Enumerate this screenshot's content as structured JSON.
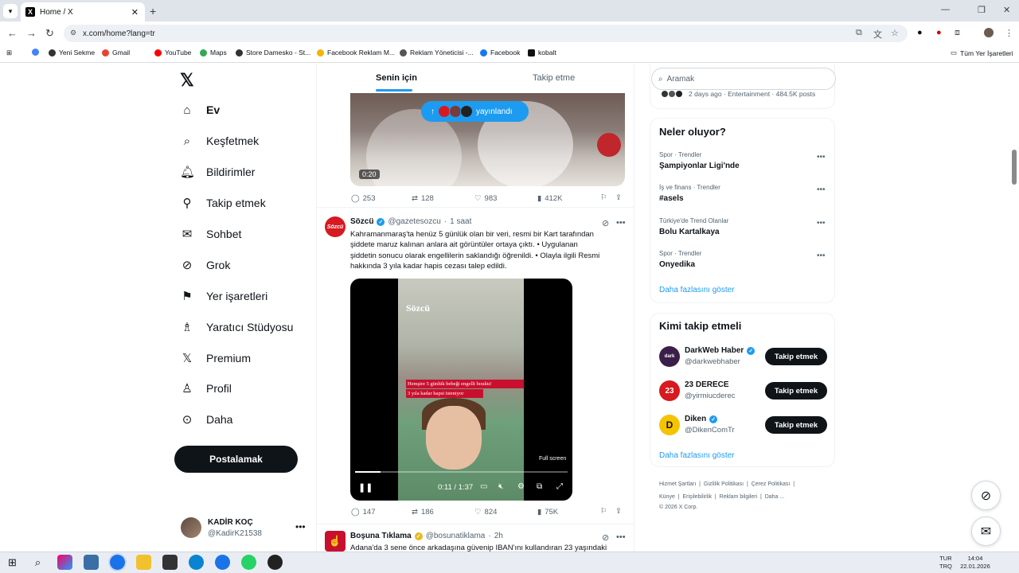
{
  "browser": {
    "tab_title": "Home / X",
    "url": "x.com/home?lang=tr",
    "bookmarks": [
      {
        "label": "Yeni Sekme",
        "color": "#333"
      },
      {
        "label": "Gmail",
        "color": "#ea4335"
      },
      {
        "label": "YouTube",
        "color": "#ff0000"
      },
      {
        "label": "Maps",
        "color": "#34a853"
      },
      {
        "label": "Store Damesko - St...",
        "color": "#333"
      },
      {
        "label": "Facebook Reklam M...",
        "color": "#f4b400"
      },
      {
        "label": "Reklam Yöneticisi -...",
        "color": "#555"
      },
      {
        "label": "Facebook",
        "color": "#1877f2"
      },
      {
        "label": "kobalt",
        "color": "#111"
      }
    ],
    "all_bookmarks": "Tüm Yer İşaretleri"
  },
  "nav": {
    "items": [
      {
        "label": "Ev",
        "icon": "home-icon"
      },
      {
        "label": "Keşfetmek",
        "icon": "search-icon"
      },
      {
        "label": "Bildirimler",
        "icon": "bell-icon"
      },
      {
        "label": "Takip etmek",
        "icon": "person-add-icon"
      },
      {
        "label": "Sohbet",
        "icon": "mail-icon"
      },
      {
        "label": "Grok",
        "icon": "grok-icon"
      },
      {
        "label": "Yer işaretleri",
        "icon": "bookmark-icon"
      },
      {
        "label": "Yaratıcı Stüdyosu",
        "icon": "studio-icon"
      },
      {
        "label": "Premium",
        "icon": "x-icon"
      },
      {
        "label": "Profil",
        "icon": "person-icon"
      },
      {
        "label": "Daha",
        "icon": "more-icon"
      }
    ],
    "post_label": "Postalamak",
    "user": {
      "name": "KADİR KOÇ",
      "handle": "@KadirK21538"
    }
  },
  "feed": {
    "tabs": [
      "Senin için",
      "Takip etme"
    ],
    "new_posts_label": "yayınlandı",
    "video1_time": "0:20",
    "tweet1_stats": {
      "replies": "253",
      "reposts": "128",
      "likes": "983",
      "views": "412K"
    },
    "tweet2": {
      "name": "Sözcü",
      "handle": "@gazetesozcu",
      "time": "1 saat",
      "lines": [
        "Kahramanmaraş'ta henüz 5 günlük olan bir veri, resmi bir Kart tarafından",
        "şiddete maruz kalınan anlara ait görüntüler ortaya çıktı. • Uygulanan",
        "şiddetin sonucu olarak engellilerin saklandığı öğrenildi. • Olayla ilgili Resmi",
        "hakkında 3 yıla kadar hapis cezası talep edildi."
      ],
      "video_logo": "Sözcü",
      "video_caption1": "Hemşire 5 günlük bebeği engelli bıraktı!",
      "video_caption2": "3 yıla kadar hapsi isteniyor",
      "video_time": "0:11 / 1:37",
      "fullscreen_label": "Full screen",
      "stats": {
        "replies": "147",
        "reposts": "186",
        "likes": "824",
        "views": "75K"
      }
    },
    "tweet3": {
      "name": "Boşuna Tıklama",
      "handle": "@bosunatiklama",
      "time": "2h",
      "text": "Adana'da 3 sene önce arkadaşına güvenip IBAN'ını kullandıran 23 yaşındaki"
    }
  },
  "sidebar": {
    "search_placeholder": "Aramak",
    "top_meta": "2 days ago · Entertainment · 484.5K posts",
    "trends_title": "Neler oluyor?",
    "trends": [
      {
        "category": "Spor · Trendler",
        "name": "Şampiyonlar Ligi'nde"
      },
      {
        "category": "İş ve finans · Trendler",
        "name": "#asels"
      },
      {
        "category": "Türkiye'de Trend Olanlar",
        "name": "Bolu Kartalkaya"
      },
      {
        "category": "Spor · Trendler",
        "name": "Onyedika"
      }
    ],
    "show_more": "Daha fazlasını göster",
    "follow_title": "Kimi takip etmeli",
    "follow": [
      {
        "name": "DarkWeb Haber",
        "handle": "@darkwebhaber",
        "color": "#3b1f4a",
        "initials": "dark",
        "verified": true
      },
      {
        "name": "23 DERECE",
        "handle": "@yirmiucderec",
        "color": "#d71920",
        "initials": "23",
        "verified": false
      },
      {
        "name": "Diken",
        "handle": "@DikenComTr",
        "color": "#f5c400",
        "initials": "D",
        "verified": true
      }
    ],
    "follow_button": "Takip etmek",
    "footer_line1": [
      "Hizmet Şartları",
      "Gizlilik Politikası",
      "Çerez Politikası"
    ],
    "footer_line2": [
      "Künye",
      "Erişilebilirlik",
      "Reklam bilgileri",
      "Daha ..."
    ],
    "copyright": "© 2026 X Corp."
  },
  "taskbar": {
    "lang": "TUR",
    "lang2": "TRQ",
    "time": "14:04",
    "date": "22.01.2026"
  }
}
